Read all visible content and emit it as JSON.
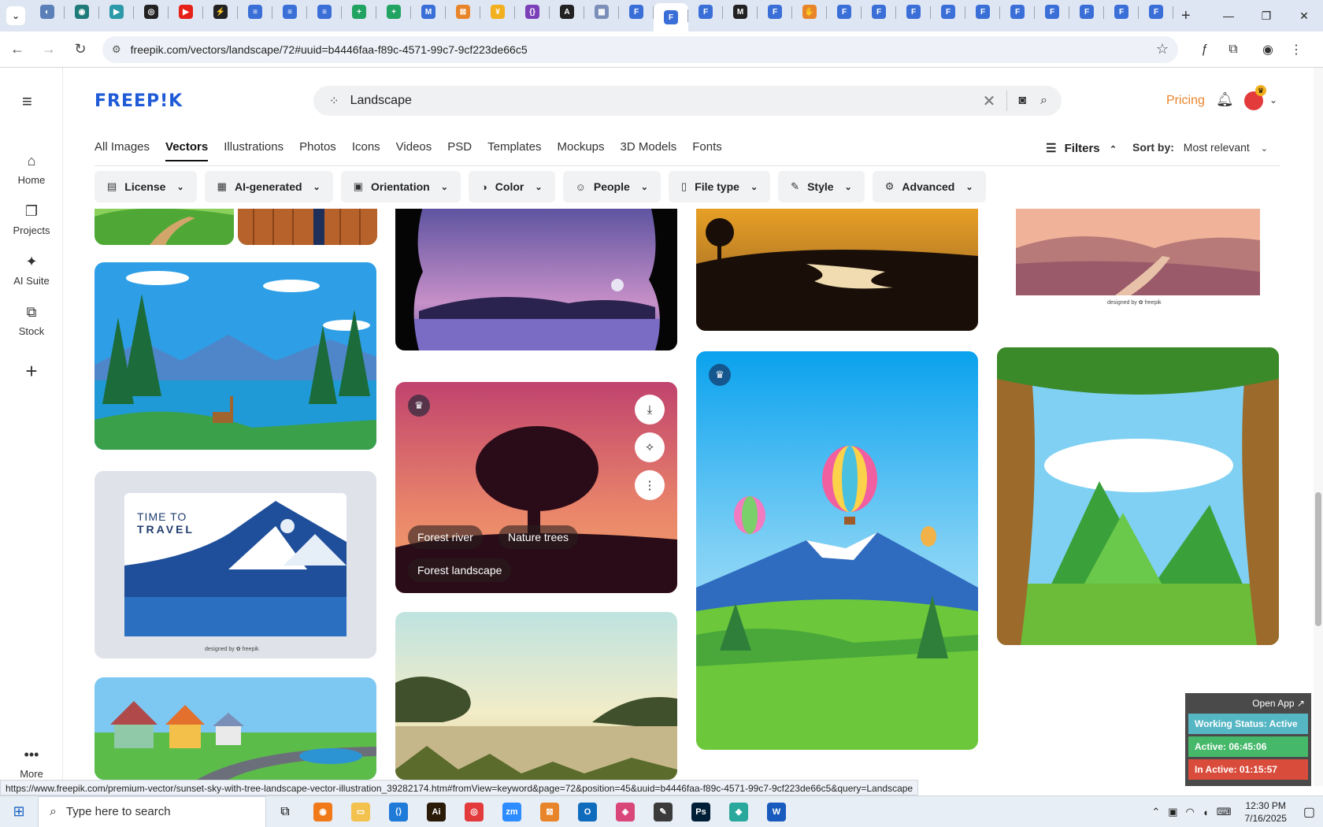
{
  "browser": {
    "tabs": [
      {
        "color": "#5b7fb8",
        "glyph": "◐"
      },
      {
        "color": "#1f7a7a",
        "glyph": "◉"
      },
      {
        "color": "#2c9aa8",
        "glyph": "▶"
      },
      {
        "color": "#222222",
        "glyph": "◎"
      },
      {
        "color": "#e62117",
        "glyph": "▶"
      },
      {
        "color": "#222222",
        "glyph": "⚡"
      },
      {
        "color": "#3b6fd8",
        "glyph": "≡"
      },
      {
        "color": "#3b6fd8",
        "glyph": "≡"
      },
      {
        "color": "#3b6fd8",
        "glyph": "≡"
      },
      {
        "color": "#21a362",
        "glyph": "+"
      },
      {
        "color": "#21a362",
        "glyph": "+"
      },
      {
        "color": "#3b6fd8",
        "glyph": "M"
      },
      {
        "color": "#e8852b",
        "glyph": "⊠"
      },
      {
        "color": "#f2b01e",
        "glyph": "¥"
      },
      {
        "color": "#7b3fb8",
        "glyph": "{}"
      },
      {
        "color": "#222222",
        "glyph": "A"
      },
      {
        "color": "#7b8fb8",
        "glyph": "▦"
      },
      {
        "color": "#3b6fd8",
        "glyph": "F"
      },
      {
        "color": "#3b6fd8",
        "glyph": "F",
        "active": true
      },
      {
        "color": "#3b6fd8",
        "glyph": "F"
      },
      {
        "color": "#222222",
        "glyph": "M"
      },
      {
        "color": "#3b6fd8",
        "glyph": "F"
      },
      {
        "color": "#e8852b",
        "glyph": "✋"
      },
      {
        "color": "#3b6fd8",
        "glyph": "F"
      },
      {
        "color": "#3b6fd8",
        "glyph": "F"
      },
      {
        "color": "#3b6fd8",
        "glyph": "F"
      },
      {
        "color": "#3b6fd8",
        "glyph": "F"
      },
      {
        "color": "#3b6fd8",
        "glyph": "F"
      },
      {
        "color": "#3b6fd8",
        "glyph": "F"
      },
      {
        "color": "#3b6fd8",
        "glyph": "F"
      },
      {
        "color": "#3b6fd8",
        "glyph": "F"
      },
      {
        "color": "#3b6fd8",
        "glyph": "F"
      },
      {
        "color": "#3b6fd8",
        "glyph": "F"
      }
    ],
    "url": "freepik.com/vectors/landscape/72#uuid=b4446faa-f89c-4571-99c7-9cf223de66c5",
    "status_url": "https://www.freepik.com/premium-vector/sunset-sky-with-tree-landscape-vector-illustration_39282174.htm#fromView=keyword&page=72&position=45&uuid=b4446faa-f89c-4571-99c7-9cf223de66c5&query=Landscape"
  },
  "sidebar": {
    "items": [
      {
        "label": "Home",
        "icon": "⌂"
      },
      {
        "label": "Projects",
        "icon": "❐"
      },
      {
        "label": "AI Suite",
        "icon": "✦"
      },
      {
        "label": "Stock",
        "icon": "⧉"
      }
    ],
    "add_icon": "+",
    "more_label": "More"
  },
  "header": {
    "logo": "FREEP!K",
    "search_value": "Landscape",
    "pricing": "Pricing"
  },
  "type_tabs": [
    "All Images",
    "Vectors",
    "Illustrations",
    "Photos",
    "Icons",
    "Videos",
    "PSD",
    "Templates",
    "Mockups",
    "3D Models",
    "Fonts"
  ],
  "active_type_tab": "Vectors",
  "filters_label": "Filters",
  "sort": {
    "label": "Sort by:",
    "value": "Most relevant"
  },
  "filter_chips": [
    {
      "label": "License",
      "icon": "▤"
    },
    {
      "label": "AI-generated",
      "icon": "▦"
    },
    {
      "label": "Orientation",
      "icon": "▣"
    },
    {
      "label": "Color",
      "icon": "◑"
    },
    {
      "label": "People",
      "icon": "☺"
    },
    {
      "label": "File type",
      "icon": "▯"
    },
    {
      "label": "Style",
      "icon": "✎"
    },
    {
      "label": "Advanced",
      "icon": "⚙"
    }
  ],
  "hover_card": {
    "tags": [
      "Forest river",
      "Nature trees",
      "Forest landscape"
    ]
  },
  "travel_card": {
    "line1": "TIME TO",
    "line2": "TRAVEL",
    "footer": "designed by ✿ freepik"
  },
  "pink_card": {
    "footer": "designed by ✿ freepik"
  },
  "work_status": {
    "open_app": "Open App ↗",
    "status": "Working Status: Active",
    "active": "Active: 06:45:06",
    "inactive": "In Active: 01:15:57"
  },
  "taskbar": {
    "search_placeholder": "Type here to search",
    "time": "12:30 PM",
    "date": "7/16/2025",
    "apps": [
      {
        "color": "#f07a1a",
        "glyph": "◉"
      },
      {
        "color": "#f2c14e",
        "glyph": "▭"
      },
      {
        "color": "#1f7ad8",
        "glyph": "⟨⟩"
      },
      {
        "color": "#2a1a08",
        "glyph": "Ai"
      },
      {
        "color": "#e33b3b",
        "glyph": "◎"
      },
      {
        "color": "#2d8cff",
        "glyph": "zm"
      },
      {
        "color": "#e8852b",
        "glyph": "⊠"
      },
      {
        "color": "#0f6cbd",
        "glyph": "O"
      },
      {
        "color": "#d9467a",
        "glyph": "◈"
      },
      {
        "color": "#3b3b3b",
        "glyph": "✎"
      },
      {
        "color": "#001e36",
        "glyph": "Ps"
      },
      {
        "color": "#2aa89c",
        "glyph": "◆"
      },
      {
        "color": "#185abd",
        "glyph": "W"
      }
    ]
  }
}
